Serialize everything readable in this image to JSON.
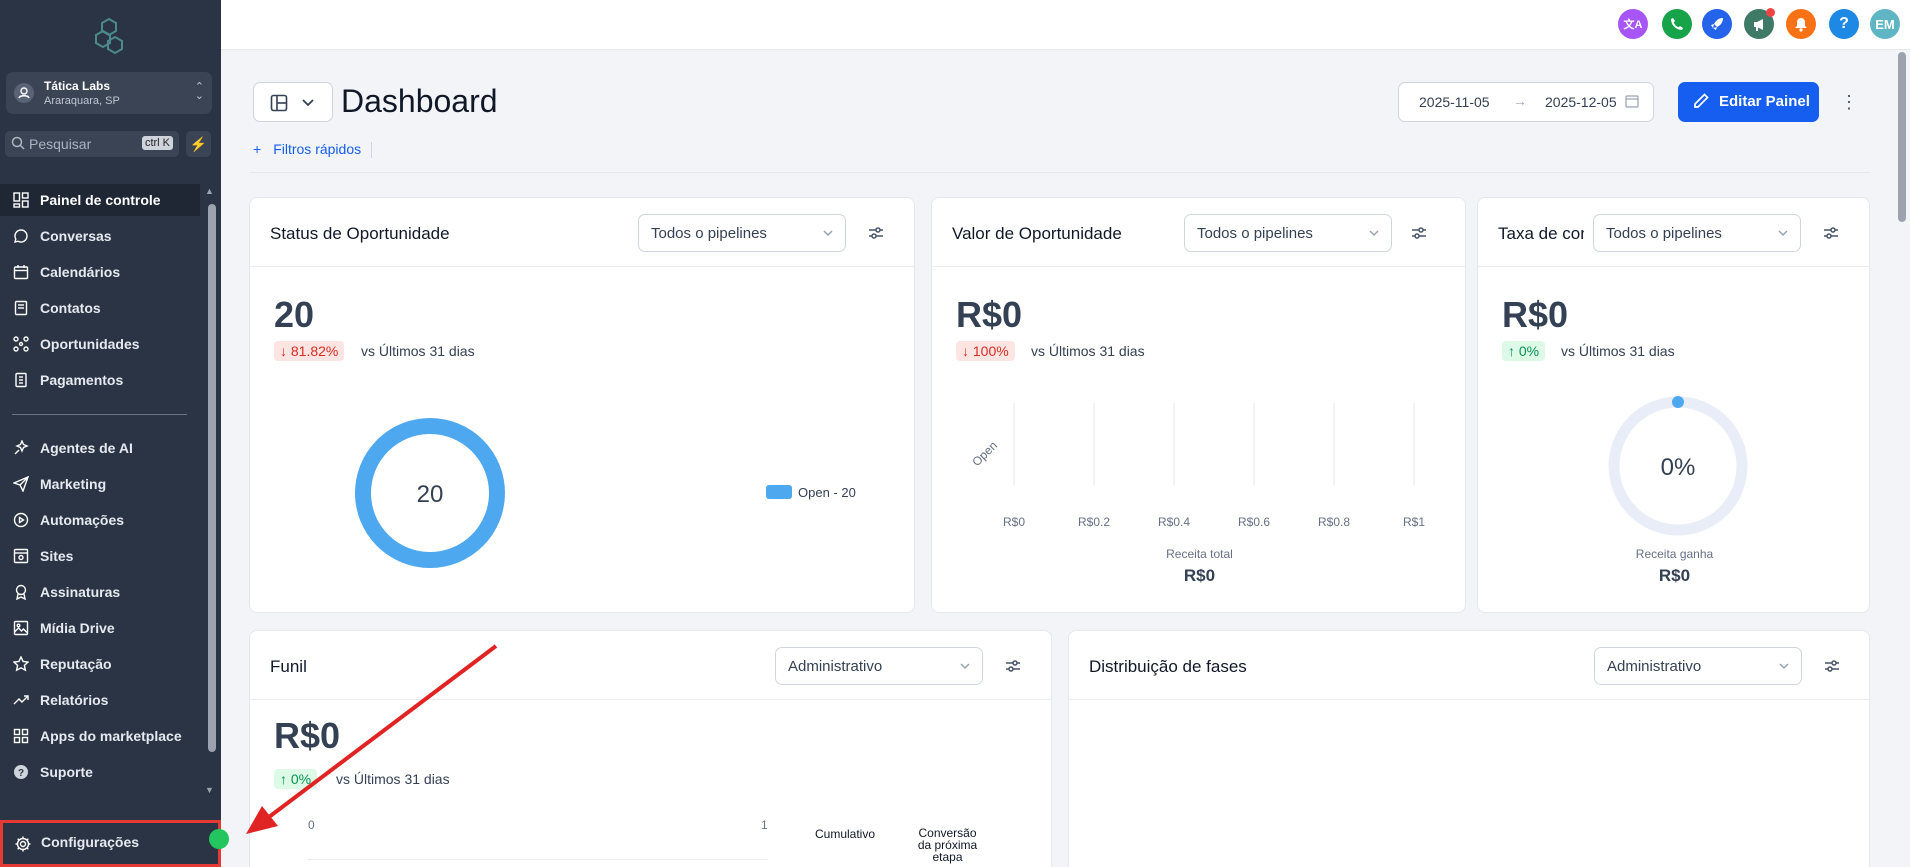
{
  "sidebar": {
    "location": {
      "name": "Tática Labs",
      "city": "Araraquara, SP"
    },
    "search": {
      "placeholder": "Pesquisar",
      "shortcut": "ctrl K"
    },
    "items": [
      {
        "label": "Painel de controle",
        "icon": "dashboard-grid-icon",
        "active": true
      },
      {
        "label": "Conversas",
        "icon": "chat-bubble-icon"
      },
      {
        "label": "Calendários",
        "icon": "calendar-icon"
      },
      {
        "label": "Contatos",
        "icon": "contacts-book-icon"
      },
      {
        "label": "Oportunidades",
        "icon": "opportunities-nodes-icon"
      },
      {
        "label": "Pagamentos",
        "icon": "payments-receipt-icon"
      },
      {
        "label": "Agentes de AI",
        "icon": "ai-sparkle-icon"
      },
      {
        "label": "Marketing",
        "icon": "send-paper-plane-icon"
      },
      {
        "label": "Automações",
        "icon": "automation-play-icon"
      },
      {
        "label": "Sites",
        "icon": "sites-browser-icon"
      },
      {
        "label": "Assinaturas",
        "icon": "membership-badge-icon"
      },
      {
        "label": "Mídia Drive",
        "icon": "media-image-icon"
      },
      {
        "label": "Reputação",
        "icon": "reputation-star-icon"
      },
      {
        "label": "Relatórios",
        "icon": "reports-trend-icon"
      },
      {
        "label": "Apps do marketplace",
        "icon": "apps-grid-icon"
      },
      {
        "label": "Suporte",
        "icon": "support-question-icon"
      }
    ],
    "settings_label": "Configurações"
  },
  "topbar": {
    "icons": [
      {
        "name": "translate-icon",
        "color": "#a855f7",
        "glyph": "文A"
      },
      {
        "name": "phone-icon",
        "color": "#16a34a",
        "glyph": "✆"
      },
      {
        "name": "rocket-icon",
        "color": "#2563eb",
        "glyph": "🚀"
      },
      {
        "name": "megaphone-icon",
        "color": "#3f7a66",
        "glyph": "📢"
      },
      {
        "name": "notification-bell-icon",
        "color": "#f97316",
        "glyph": "🔔"
      },
      {
        "name": "help-icon",
        "color": "#1e88e5",
        "glyph": "?"
      },
      {
        "name": "user-avatar",
        "color": "#5fb5c4",
        "glyph": "EM"
      }
    ]
  },
  "header": {
    "title": "Dashboard",
    "date_from": "2025-11-05",
    "date_to": "2025-12-05",
    "edit_button": "Editar Painel",
    "quick_filters": "Filtros rápidos"
  },
  "cards": {
    "status": {
      "title": "Status de Oportunidade",
      "select": "Todos o pipelines",
      "value": "20",
      "change": "81.82%",
      "vs": "vs Últimos 31 dias",
      "donut_label": "20",
      "legend": "Open - 20"
    },
    "valor": {
      "title": "Valor de Oportunidade",
      "select": "Todos o pipelines",
      "value": "R$0",
      "change": "100%",
      "vs": "vs Últimos 31 dias",
      "y_category": "Open",
      "x_ticks": [
        "R$0",
        "R$0.2",
        "R$0.4",
        "R$0.6",
        "R$0.8",
        "R$1"
      ],
      "bottom_label": "Receita total",
      "bottom_value": "R$0"
    },
    "taxa": {
      "title": "Taxa de con",
      "select": "Todos o pipelines",
      "value": "R$0",
      "change": "0%",
      "vs": "vs Últimos 31 dias",
      "gauge_label": "0%",
      "bottom_label": "Receita ganha",
      "bottom_value": "R$0"
    },
    "funil": {
      "title": "Funil",
      "select": "Administrativo",
      "value": "R$0",
      "change": "0%",
      "vs": "vs Últimos 31 dias",
      "axis_min": "0",
      "axis_max": "1",
      "col1": "Cumulativo",
      "col2_line1": "Conversão",
      "col2_line2": "da próxima",
      "col2_line3": "etapa"
    },
    "fases": {
      "title": "Distribuição de fases",
      "select": "Administrativo"
    }
  },
  "chart_data": [
    {
      "type": "pie",
      "categories": [
        "Open"
      ],
      "values": [
        20
      ]
    },
    {
      "type": "bar",
      "categories": [
        "Open"
      ],
      "values": [
        0
      ],
      "xlim": [
        0,
        1
      ],
      "xlabel": "Receita total"
    }
  ]
}
